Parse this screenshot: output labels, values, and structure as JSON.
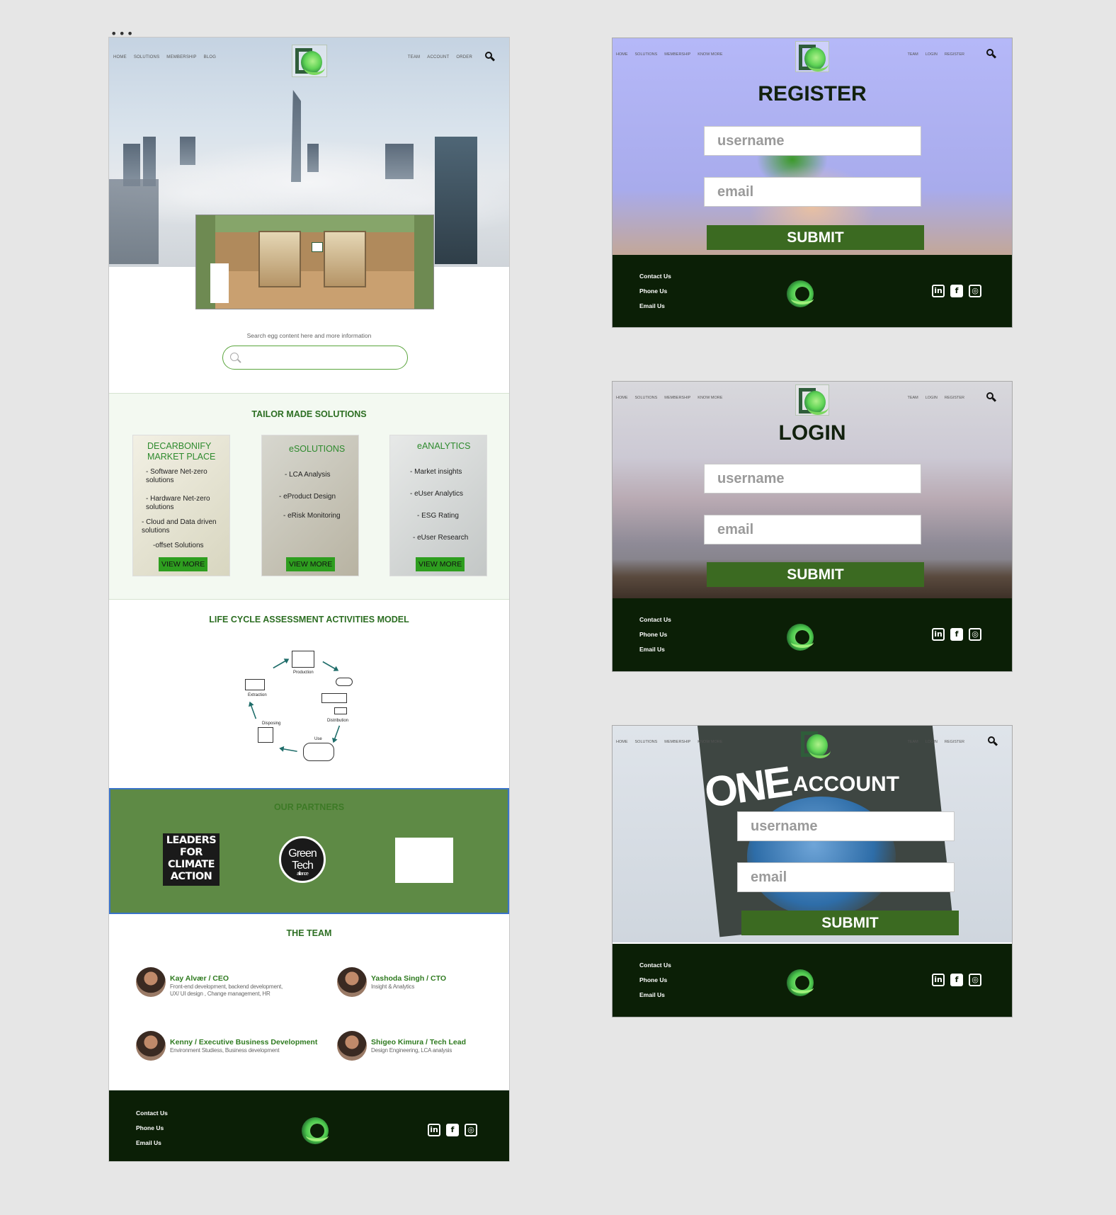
{
  "nav": {
    "left": [
      "HOME",
      "SOLUTIONS",
      "MEMBERSHIP",
      "BLOG"
    ],
    "right": [
      "TEAM",
      "ACCOUNT",
      "ORDER"
    ]
  },
  "form_nav": {
    "left": [
      "HOME",
      "SOLUTIONS",
      "MEMBERSHIP",
      "KNOW MORE"
    ],
    "right": [
      "TEAM",
      "LOGIN",
      "REGISTER"
    ]
  },
  "search": {
    "caption": "Search egg content here and more information",
    "placeholder": ""
  },
  "solutions": {
    "title": "TAILOR MADE SOLUTIONS",
    "cards": [
      {
        "title_line1": "DECARBONIFY",
        "title_line2": "MARKET PLACE",
        "items": [
          "- Software Net-zero solutions",
          "- Hardware Net-zero solutions",
          "- Cloud and Data driven solutions",
          "-offset Solutions"
        ],
        "button": "VIEW MORE"
      },
      {
        "title_line1": "eSOLUTIONS",
        "items": [
          "- LCA Analysis",
          "- eProduct Design",
          "- eRisk Monitoring"
        ],
        "button": "VIEW MORE"
      },
      {
        "title_line1": "eANALYTICS",
        "items": [
          "- Market insights",
          "- eUser Analytics",
          "- ESG Rating",
          "- eUser Research"
        ],
        "button": "VIEW MORE"
      }
    ]
  },
  "lca": {
    "title": "LIFE CYCLE ASSESSMENT ACTIVITIES MODEL",
    "stages": [
      "Production",
      "Distribution",
      "Use",
      "Disposing",
      "Extraction"
    ]
  },
  "partners": {
    "title": "OUR PARTNERS",
    "lfca": [
      "LEADERS",
      "FOR",
      "CLIMATE",
      "ACTION"
    ],
    "gta_line1": "Green",
    "gta_line2": "Tech",
    "gta_line3": "alliance"
  },
  "team": {
    "title": "THE TEAM",
    "members": [
      {
        "name": "Kay Alvær / CEO",
        "role_line1": "Front-end development, backend development,",
        "role_line2": "UX/ UI design , Change management, HR"
      },
      {
        "name": "Yashoda Singh / CTO",
        "role_line1": "Insight & Analytics",
        "role_line2": ""
      },
      {
        "name": "Kenny / Executive Business Development",
        "role_line1": "Environment Studiess, Business development",
        "role_line2": ""
      },
      {
        "name": "Shigeo Kimura / Tech Lead",
        "role_line1": "Design Engineering, LCA analysis",
        "role_line2": ""
      }
    ]
  },
  "footer": {
    "links": [
      "Contact Us",
      "Phone Us",
      "Email Us"
    ],
    "social": [
      "in",
      "f",
      "◎"
    ]
  },
  "forms": {
    "register": {
      "title": "REGISTER",
      "username": "username",
      "email": "email",
      "submit": "SUBMIT"
    },
    "login": {
      "title": "LOGIN",
      "username": "username",
      "email": "email",
      "submit": "SUBMIT"
    },
    "account": {
      "title": "ACCOUNT",
      "username": "username",
      "email": "email",
      "submit": "SUBMIT",
      "sign_text": "ONE"
    }
  },
  "colors": {
    "brand_green": "#2c6e22",
    "footer_bg": "#0b1f06",
    "partners_bg": "#5e8a45",
    "submit_bg": "#3b6a21"
  }
}
